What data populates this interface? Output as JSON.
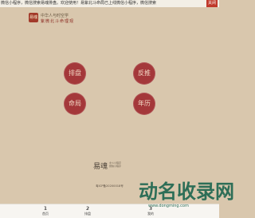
{
  "notice": {
    "text": "微信小程序，微信搜索易魂排盘。欢迎使用！易紫北斗命局已上线微信小程序，微信搜索",
    "close_label": "关闭"
  },
  "header": {
    "logo_seal_text": "易魂",
    "logo_line1": "中华人与时空学",
    "logo_line2": "紫微北斗命理观"
  },
  "buttons": {
    "paipan": "排盘",
    "fantui": "反推",
    "mingju": "命局",
    "nianli": "年历"
  },
  "brand": {
    "main": "易魂",
    "sub1": "北斗小程序",
    "sub2": "微信小程序"
  },
  "footer": {
    "icp": "粤ICP备20200018号"
  },
  "tabbar": {
    "items": [
      {
        "icon": "𝟭",
        "label": "首页"
      },
      {
        "icon": "𝟮",
        "label": "排盘"
      },
      {
        "icon": "𝟯",
        "label": "我的"
      }
    ]
  },
  "watermark": {
    "main": "动名收录网",
    "url": "www.dongming.com"
  },
  "colors": {
    "background": "#d9c7ad",
    "button": "#a4383a",
    "close_button": "#c0392b"
  }
}
